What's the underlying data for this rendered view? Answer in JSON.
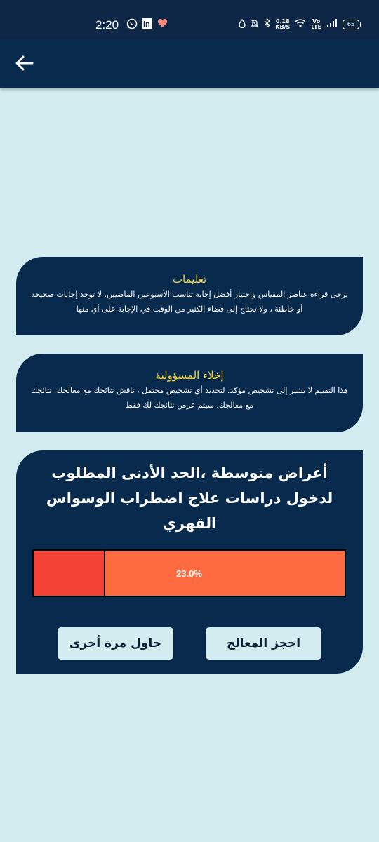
{
  "status_bar": {
    "time": "2:20",
    "net_speed_value": "0.18",
    "net_speed_unit": "KB/S",
    "network_label_top": "Vo",
    "network_label_bottom": "LTE",
    "battery": "65"
  },
  "instructions": {
    "title": "تعليمات",
    "body": "يرجى قراءة عناصر المقياس واختيار أفضل إجابة تناسب الأسبوعين الماضيين. لا توجد إجابات صحيحة أو خاطئة ، ولا تحتاج إلى قضاء الكثير من الوقت في الإجابة على أي منها"
  },
  "disclaimer": {
    "title": "إخلاء المسؤولية",
    "body": "هذا التقييم لا يشير إلى تشخيص مؤكد. لتحديد أي تشخيص محتمل ، ناقش نتائجك مع معالجك. نتائجك مع معالجك. سيتم عرض نتائجك لك فقط"
  },
  "result": {
    "heading": "أعراض متوسطة ،الحد الأدنى المطلوب لدخول دراسات علاج اضطراب الوسواس القهري",
    "progress_label": "23.0%",
    "progress_fraction": 0.23,
    "book_button": "احجز المعالج",
    "retry_button": "حاول مرة أخرى"
  },
  "colors": {
    "background": "#d3ecef",
    "card": "#072a4d",
    "title_accent": "#f6d33b",
    "progress_fill": "#f44336",
    "progress_track": "#ff6b40"
  }
}
